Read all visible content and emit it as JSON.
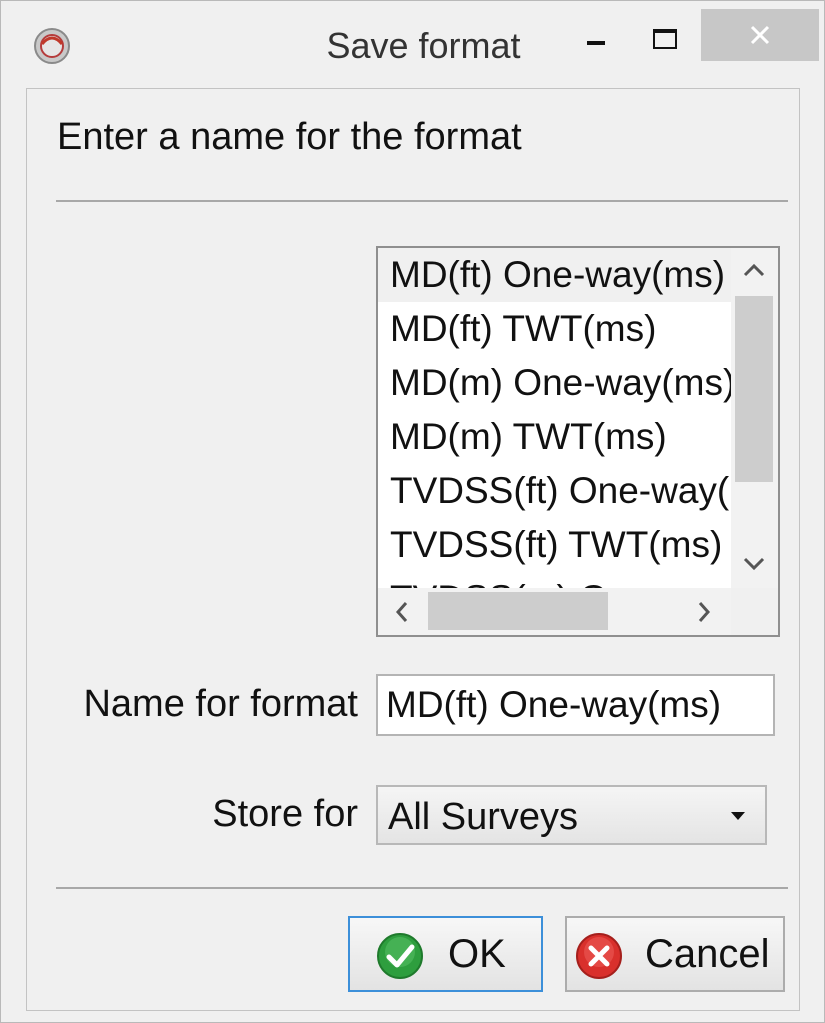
{
  "window": {
    "title": "Save format",
    "icons": {
      "app": "app-icon",
      "minimize": "minimize-icon",
      "maximize": "maximize-icon",
      "close": "close-icon"
    }
  },
  "prompt": "Enter a name for the format",
  "formats": {
    "items": [
      "MD(ft) One-way(ms)",
      "MD(ft) TWT(ms)",
      "MD(m) One-way(ms)",
      "MD(m) TWT(ms)",
      "TVDSS(ft) One-way(ms)",
      "TVDSS(ft) TWT(ms)",
      "TVDSS(m) One-way(ms)"
    ],
    "selected": 0
  },
  "name_field": {
    "label": "Name for format",
    "value": "MD(ft) One-way(ms)"
  },
  "store_for": {
    "label": "Store for",
    "value": "All Surveys"
  },
  "buttons": {
    "ok": "OK",
    "cancel": "Cancel"
  },
  "colors": {
    "ok_icon": "#2e9e3e",
    "cancel_icon": "#d9302c",
    "focus_border": "#3c8fd9"
  }
}
